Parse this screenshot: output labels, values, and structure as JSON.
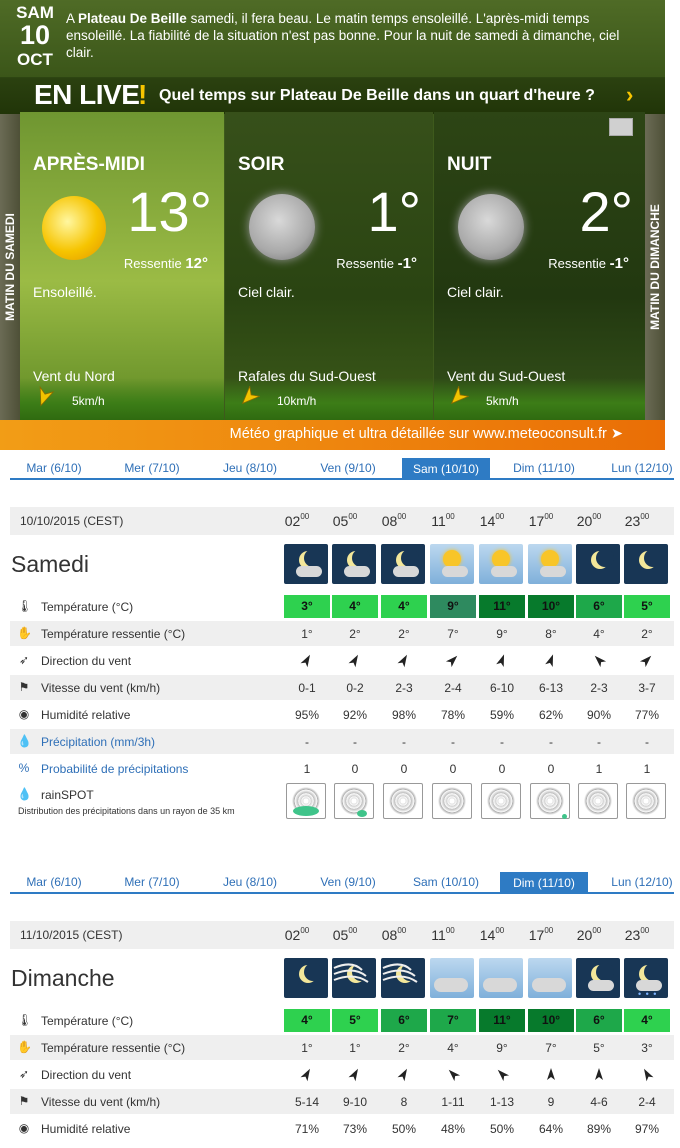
{
  "header": {
    "date": {
      "dow": "SAM",
      "day": "10",
      "month": "OCT"
    },
    "summary_prefix": "A ",
    "summary_place": "Plateau De Beille",
    "summary_text": " samedi, il fera beau. Le matin temps ensoleillé. L'après-midi temps ensoleillé. La fiabilité de la situation n'est pas bonne. Pour la nuit de samedi à dimanche, ciel clair."
  },
  "live": {
    "label": "EN LIVE",
    "bang": "!",
    "question": "Quel temps sur Plateau De Beille dans un quart d'heure ?",
    "arrow": "›"
  },
  "side": {
    "left": "MATIN DU SAMEDI",
    "right": "MATIN DU DIMANCHE"
  },
  "panels": [
    {
      "name": "APRÈS-MIDI",
      "temp": "13°",
      "feel_label": "Ressentie",
      "feel": "12°",
      "cond": "Ensoleillé.",
      "wind": "Vent du Nord",
      "speed": "5km/h",
      "icon": "sun-icon"
    },
    {
      "name": "SOIR",
      "temp": "1°",
      "feel_label": "Ressentie",
      "feel": "-1°",
      "cond": "Ciel clair.",
      "wind": "Rafales du Sud-Ouest",
      "speed": "10km/h",
      "icon": "moon-icon"
    },
    {
      "name": "NUIT",
      "temp": "2°",
      "feel_label": "Ressentie",
      "feel": "-1°",
      "cond": "Ciel clair.",
      "wind": "Vent du Sud-Ouest",
      "speed": "5km/h",
      "icon": "moon-icon"
    }
  ],
  "banner": "Météo graphique et ultra détaillée sur www.meteoconsult.fr ➤",
  "tabs": [
    "Mar (6/10)",
    "Mer (7/10)",
    "Jeu (8/10)",
    "Ven (9/10)",
    "Sam (10/10)",
    "Dim (11/10)",
    "Lun (12/10)"
  ],
  "hours": [
    "02",
    "05",
    "08",
    "11",
    "14",
    "17",
    "20",
    "23"
  ],
  "hour_suffix": "00",
  "labels": {
    "temp": "Température (°C)",
    "feel": "Température ressentie (°C)",
    "dir": "Direction du vent",
    "speed": "Vitesse du vent (km/h)",
    "hum": "Humidité relative",
    "prec": "Précipitation (mm/3h)",
    "prob": "Probabilité de précipitations",
    "rain": "rainSPOT",
    "rain_sub": "Distribution des précipitations dans un rayon de 35 km"
  },
  "colors": {
    "accent": "#2e7bc4",
    "temp_light": "#2ed14f",
    "temp_mid": "#1ea84a",
    "temp_dark": "#077a2c",
    "temp_grey": "#2e8a5f"
  },
  "days": [
    {
      "date": "10/10/2015 (CEST)",
      "name": "Samedi",
      "active_tab": 4,
      "icons": [
        "night-cloud-icon",
        "night-cloud-icon",
        "night-cloud-icon",
        "sun-cloud-icon",
        "sun-cloud-icon",
        "sun-cloud-icon",
        "moon-icon",
        "moon-icon"
      ],
      "temp": [
        "3°",
        "4°",
        "4°",
        "9°",
        "11°",
        "10°",
        "6°",
        "5°"
      ],
      "temp_color": [
        "#2ed14f",
        "#2ed14f",
        "#2ed14f",
        "#2e8a5f",
        "#077a2c",
        "#077a2c",
        "#1ea84a",
        "#2ed14f"
      ],
      "feel": [
        "1°",
        "2°",
        "2°",
        "7°",
        "9°",
        "8°",
        "4°",
        "2°"
      ],
      "dir": [
        210,
        210,
        210,
        225,
        200,
        200,
        135,
        225
      ],
      "speed": [
        "0-1",
        "0-2",
        "2-3",
        "2-4",
        "6-10",
        "6-13",
        "2-3",
        "3-7"
      ],
      "hum": [
        "95%",
        "92%",
        "98%",
        "78%",
        "59%",
        "62%",
        "90%",
        "77%"
      ],
      "prec": [
        "-",
        "-",
        "-",
        "-",
        "-",
        "-",
        "-",
        "-"
      ],
      "prob": [
        "1",
        "0",
        "0",
        "0",
        "0",
        "0",
        "1",
        "1"
      ]
    },
    {
      "date": "11/10/2015 (CEST)",
      "name": "Dimanche",
      "active_tab": 5,
      "icons": [
        "moon-icon",
        "night-wind-icon",
        "night-wind-icon",
        "cloud-icon",
        "cloud-icon",
        "cloud-icon",
        "night-cloud-icon",
        "night-rain-icon"
      ],
      "temp": [
        "4°",
        "5°",
        "6°",
        "7°",
        "11°",
        "10°",
        "6°",
        "4°"
      ],
      "temp_color": [
        "#2ed14f",
        "#2ed14f",
        "#1ea84a",
        "#1ea84a",
        "#077a2c",
        "#077a2c",
        "#1ea84a",
        "#2ed14f"
      ],
      "feel": [
        "1°",
        "1°",
        "2°",
        "4°",
        "9°",
        "7°",
        "5°",
        "3°"
      ],
      "dir": [
        210,
        210,
        210,
        135,
        135,
        180,
        180,
        150
      ],
      "speed": [
        "5-14",
        "9-10",
        "8",
        "1-11",
        "1-13",
        "9",
        "4-6",
        "2-4"
      ],
      "hum": [
        "71%",
        "73%",
        "50%",
        "48%",
        "50%",
        "64%",
        "89%",
        "97%"
      ]
    }
  ]
}
